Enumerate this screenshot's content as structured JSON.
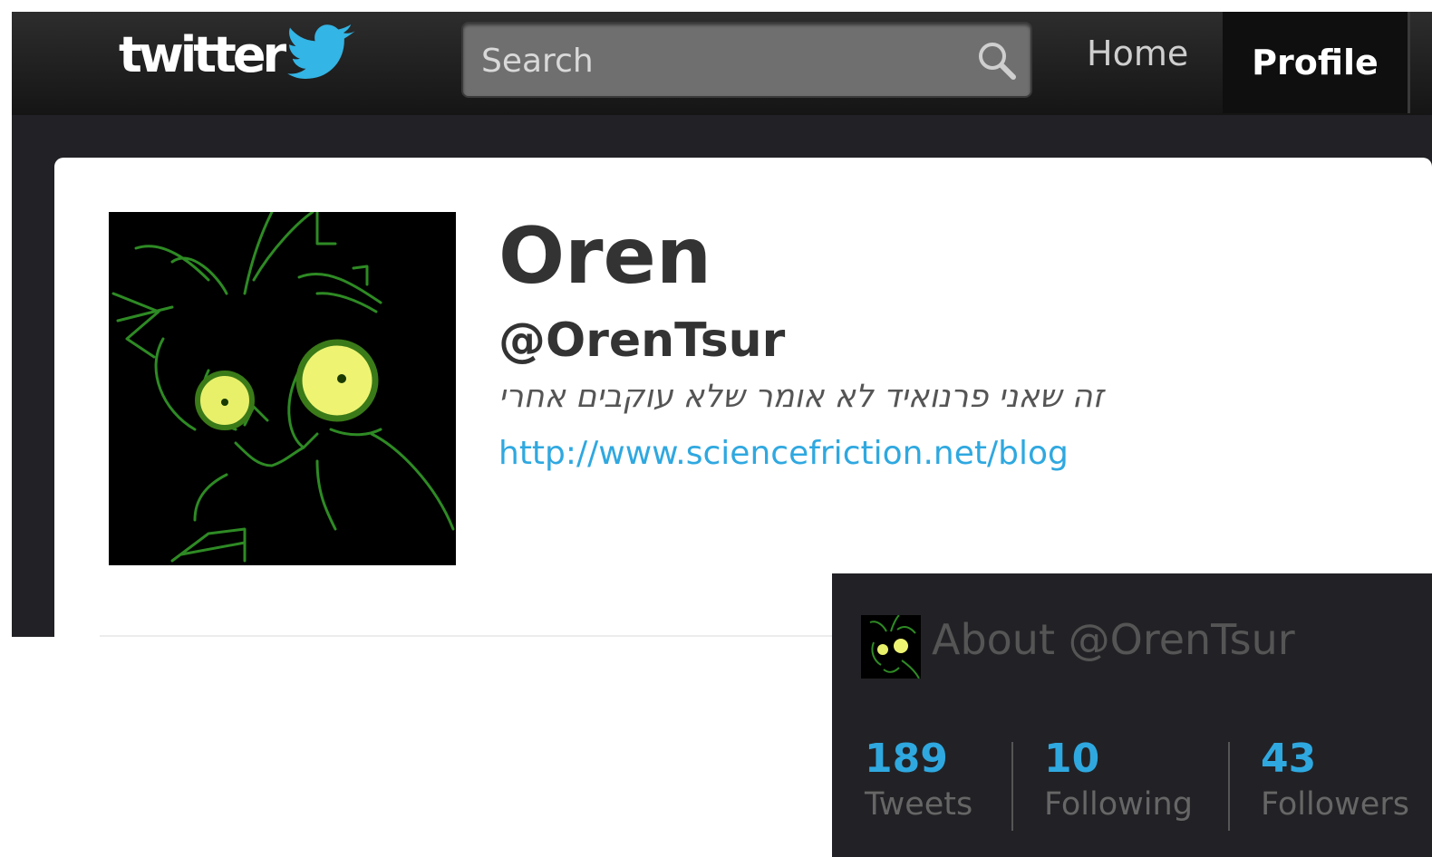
{
  "header": {
    "logo_text": "twitter",
    "search": {
      "placeholder": "Search",
      "value": ""
    },
    "nav": {
      "home": "Home",
      "profile": "Profile"
    }
  },
  "profile": {
    "name": "Oren",
    "handle": "@OrenTsur",
    "bio": "זה שאני פרנואיד לא אומר שלא עוקבים אחרי",
    "url": "http://www.sciencefriction.net/blog"
  },
  "about_panel": {
    "title": "About @OrenTsur",
    "stats": [
      {
        "value": "189",
        "label": "Tweets"
      },
      {
        "value": "10",
        "label": "Following"
      },
      {
        "value": "43",
        "label": "Followers"
      }
    ]
  },
  "colors": {
    "topbar": "#1a1a1a",
    "page_background": "#222226",
    "link": "#2fa8e0",
    "bird": "#33b5e5"
  },
  "icons": [
    "twitter-bird-icon",
    "search-icon"
  ]
}
